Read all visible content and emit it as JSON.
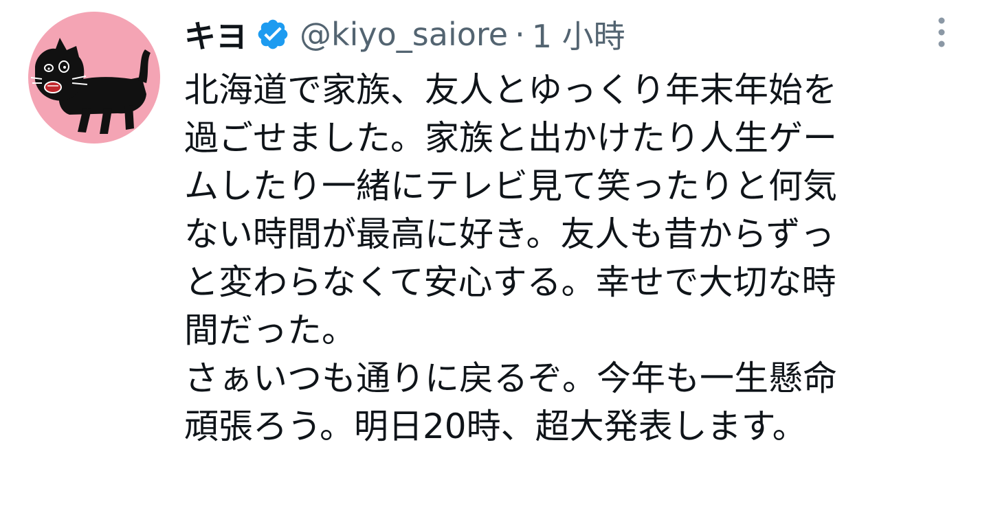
{
  "tweet": {
    "avatar_icon": "black-cat-avatar-icon",
    "display_name": "キヨ",
    "verified_icon": "verified-badge-icon",
    "handle": "@kiyo_saiore",
    "separator": "·",
    "time": "1 小時",
    "more_icon": "vertical-ellipsis-icon",
    "body_lines": [
      "北海道で家族、友人とゆっくり年末年始を",
      "過ごせました。家族と出かけたり人生ゲー",
      "ムしたり一緒にテレビ見て笑ったりと何気",
      "ない時間が最高に好き。友人も昔からずっ",
      "と変わらなくて安心する。幸せで大切な時",
      "間だった。",
      "さぁいつも通りに戻るぞ。今年も一生懸命",
      "頑張ろう。明日20時、超大発表します。"
    ]
  },
  "colors": {
    "avatar_background": "#f4a4b4",
    "verified_blue": "#1d9bf0",
    "secondary_text": "#536471",
    "primary_text": "#0f1419"
  }
}
